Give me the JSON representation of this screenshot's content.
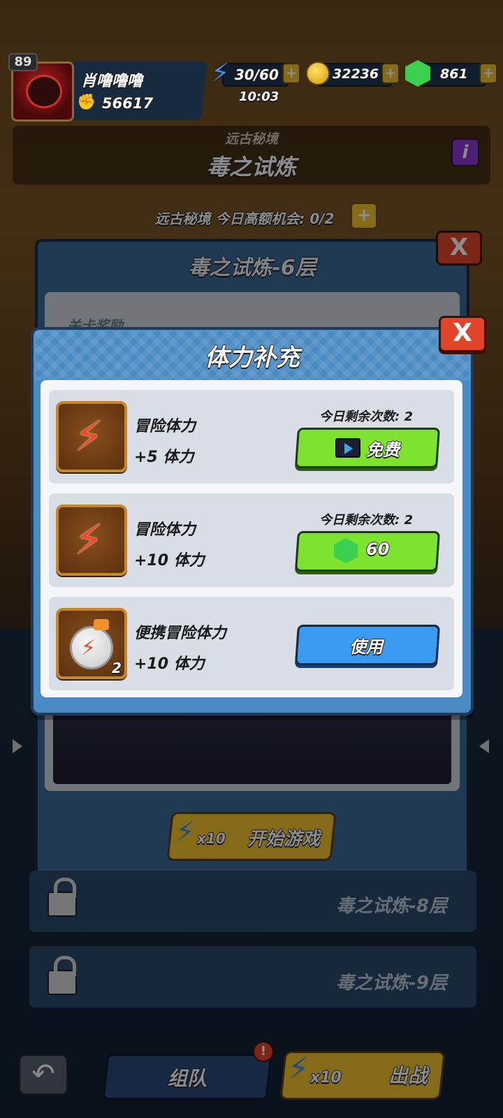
{
  "header": {
    "level": "89",
    "player_name": "肖噜噜噜",
    "power": "56617",
    "stamina": "30/60",
    "stamina_timer": "10:03",
    "coins": "32236",
    "gems": "861",
    "plus": "+"
  },
  "dungeon": {
    "subtitle": "远古秘境",
    "title": "毒之试炼",
    "info": "i",
    "chance_text": "远古秘境 今日高额机会: 0/2",
    "chance_plus": "+"
  },
  "floor_panel": {
    "title": "毒之试炼-6层",
    "close": "X",
    "reward_label": "关卡奖励",
    "start_cost": "x10",
    "start_label": "开始游戏"
  },
  "locked_floors": [
    {
      "label": "毒之试炼-8层"
    },
    {
      "label": "毒之试炼-9层"
    }
  ],
  "bottom_bar": {
    "back": "↶",
    "team_label": "组队",
    "battle_cost": "x10",
    "battle_label": "出战"
  },
  "dialog": {
    "title": "体力补充",
    "close": "X",
    "options": [
      {
        "name": "冒险体力",
        "amount": "+5 体力",
        "remaining": "今日剩余次数: 2",
        "button_label": "免费",
        "button_type": "video",
        "icon": "lightning-icon"
      },
      {
        "name": "冒险体力",
        "amount": "+10 体力",
        "remaining": "今日剩余次数: 2",
        "button_label": "60",
        "button_type": "gem",
        "icon": "lightning-icon"
      },
      {
        "name": "便携冒险体力",
        "amount": "+10 体力",
        "remaining": "",
        "button_label": "使用",
        "button_type": "use",
        "icon": "stamina-potion-icon",
        "count": "2"
      }
    ]
  },
  "colors": {
    "accent_yellow": "#f2c230",
    "accent_green": "#7ee32e",
    "accent_blue": "#3a9af0",
    "close_red": "#e0452b",
    "dialog_blue": "#4a8ac2"
  }
}
